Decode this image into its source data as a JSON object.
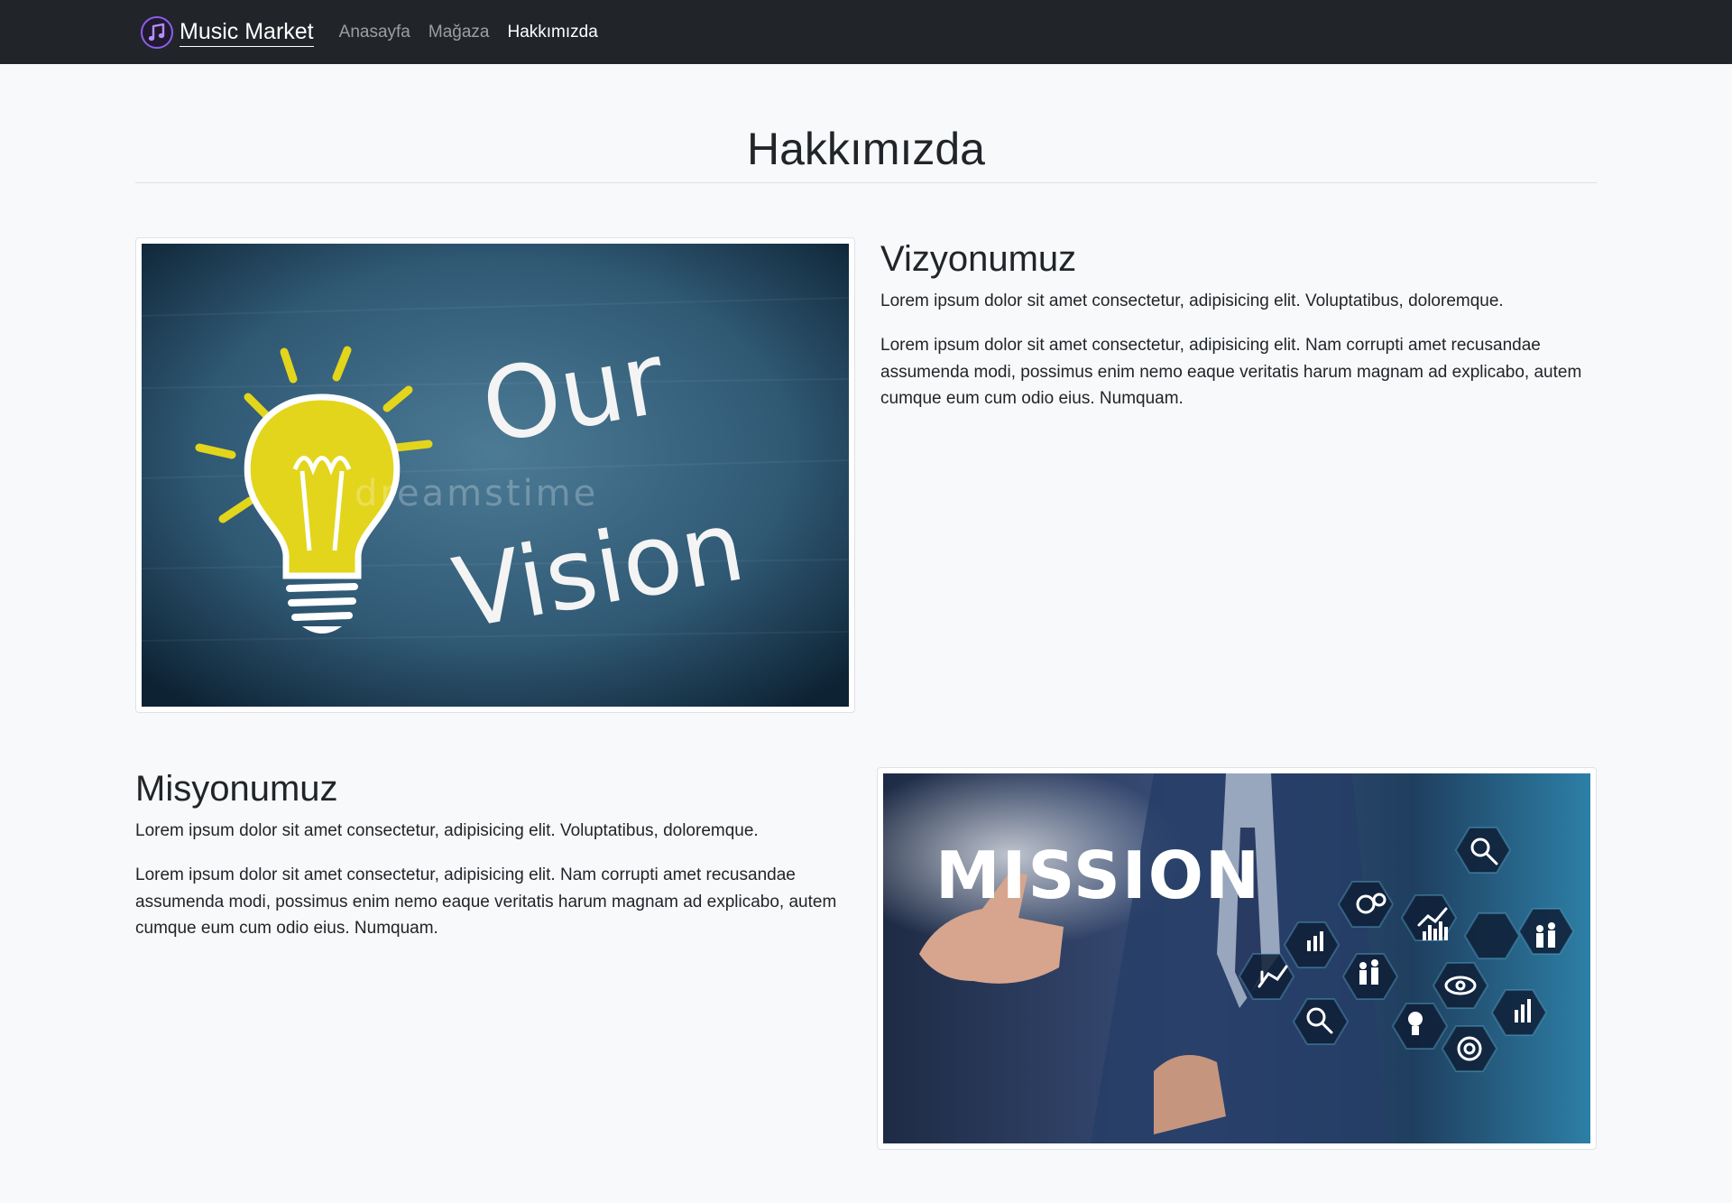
{
  "nav": {
    "brand": "Music Market",
    "links": [
      {
        "label": "Anasayfa",
        "active": false
      },
      {
        "label": "Mağaza",
        "active": false
      },
      {
        "label": "Hakkımızda",
        "active": true
      }
    ]
  },
  "page": {
    "title": "Hakkımızda"
  },
  "vision": {
    "heading": "Vizyonumuz",
    "p1": "Lorem ipsum dolor sit amet consectetur, adipisicing elit. Voluptatibus, doloremque.",
    "p2": "Lorem ipsum dolor sit amet consectetur, adipisicing elit. Nam corrupti amet recusandae assumenda modi, possimus enim nemo eaque veritatis harum magnam ad explicabo, autem cumque eum cum odio eius. Numquam.",
    "image": {
      "line1": "Our",
      "line2": "Vision",
      "watermark": "dreamstime"
    }
  },
  "mission": {
    "heading": "Misyonumuz",
    "p1": "Lorem ipsum dolor sit amet consectetur, adipisicing elit. Voluptatibus, doloremque.",
    "p2": "Lorem ipsum dolor sit amet consectetur, adipisicing elit. Nam corrupti amet recusandae assumenda modi, possimus enim nemo eaque veritatis harum magnam ad explicabo, autem cumque eum cum odio eius. Numquam.",
    "image": {
      "word": "MISSION"
    }
  },
  "colors": {
    "navbar": "#212529",
    "page_bg": "#f8f9fa",
    "logo_purple": "#8e5cf0",
    "chalkboard": "#2f5873",
    "bulb_yellow": "#e3d51b",
    "mission_bg": "#1b2c4a"
  }
}
